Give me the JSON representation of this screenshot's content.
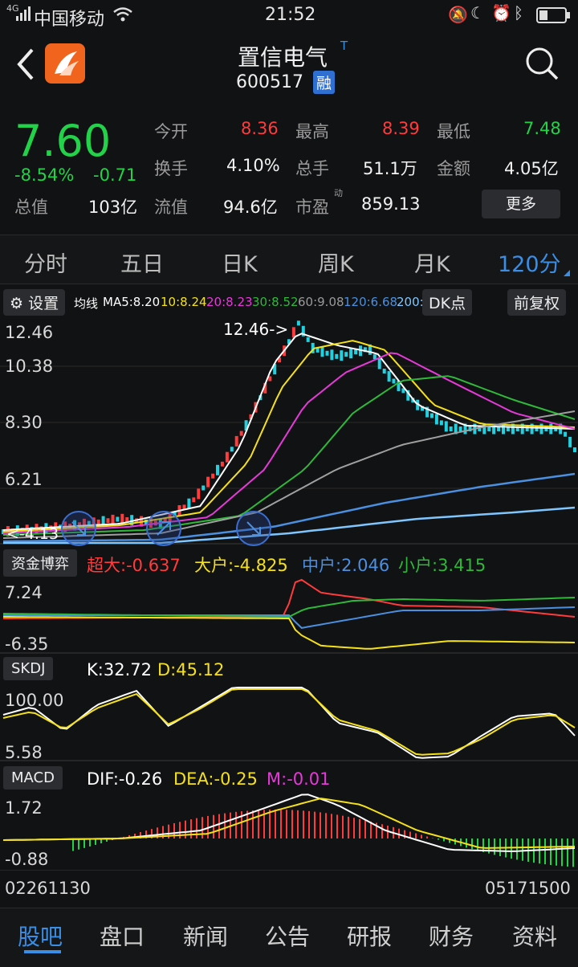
{
  "status": {
    "carrier": "中国移动",
    "signal_tag": "4G",
    "time": "21:52"
  },
  "header": {
    "title": "置信电气",
    "title_sup": "T",
    "code": "600517",
    "badge": "融"
  },
  "quote": {
    "price": "7.60",
    "change_pct": "-8.54%",
    "change_abs": "-0.71",
    "total_value_label": "总值",
    "total_value": "103亿",
    "cells": [
      {
        "label": "今开",
        "value": "8.36"
      },
      {
        "label": "最高",
        "value": "8.39"
      },
      {
        "label": "最低",
        "value": "7.48"
      },
      {
        "label": "换手",
        "value": "4.10%"
      },
      {
        "label": "总手",
        "value": "51.1万"
      },
      {
        "label": "金额",
        "value": "4.05亿"
      },
      {
        "label": "流值",
        "value": "94.6亿"
      },
      {
        "label": "市盈",
        "value": "859.13"
      }
    ],
    "pe_sup": "动",
    "more_label": "更多"
  },
  "tabs": [
    "分时",
    "五日",
    "日K",
    "周K",
    "月K",
    "120分"
  ],
  "ma_bar": {
    "settings_label": "设置",
    "ma_title": "均线",
    "ma_items": [
      {
        "text": "MA5:8.20",
        "color": "#ffffff"
      },
      {
        "text": "10:8.24",
        "color": "#f5e11a"
      },
      {
        "text": "20:8.23",
        "color": "#e63ad8"
      },
      {
        "text": "30:8.52",
        "color": "#2fb83a"
      },
      {
        "text": "60:9.08",
        "color": "#9a9a9a"
      },
      {
        "text": "120:6.68",
        "color": "#4b8fe0"
      },
      {
        "text": "200:",
        "color": "#7fc6ff"
      }
    ],
    "dk_label": "DK点",
    "fq_label": "前复权"
  },
  "kline": {
    "y_labels": [
      "12.46",
      "10.38",
      "8.30",
      "6.21"
    ],
    "max_label": "12.46->",
    "min_label": "<-4.13"
  },
  "fund": {
    "btn_label": "资金博弈",
    "items": [
      {
        "text": "超大:-0.637",
        "color": "#ff3b3b"
      },
      {
        "text": "大户:-4.825",
        "color": "#f5e11a"
      },
      {
        "text": "中户:2.046",
        "color": "#4b8fe0"
      },
      {
        "text": "小户:3.415",
        "color": "#2fb83a"
      }
    ],
    "y_labels": [
      "7.24",
      "-6.35"
    ]
  },
  "skdj": {
    "btn_label": "SKDJ",
    "items": [
      {
        "text": "K:32.72",
        "color": "#ffffff"
      },
      {
        "text": "D:45.12",
        "color": "#f5e11a"
      }
    ],
    "y_labels": [
      "100.00",
      "5.58"
    ]
  },
  "macd": {
    "btn_label": "MACD",
    "items": [
      {
        "text": "DIF:-0.26",
        "color": "#ffffff"
      },
      {
        "text": "DEA:-0.25",
        "color": "#f5e11a"
      },
      {
        "text": "M:-0.01",
        "color": "#e63ad8"
      }
    ],
    "y_labels": [
      "1.72",
      "-0.88"
    ]
  },
  "x_axis": {
    "start": "02261130",
    "end": "05171500"
  },
  "bottom_nav": [
    "股吧",
    "盘口",
    "新闻",
    "公告",
    "研报",
    "财务",
    "资料"
  ],
  "colors": {
    "up": "#ff3b3b",
    "down": "#22d34a",
    "accent": "#3a8ee6"
  }
}
